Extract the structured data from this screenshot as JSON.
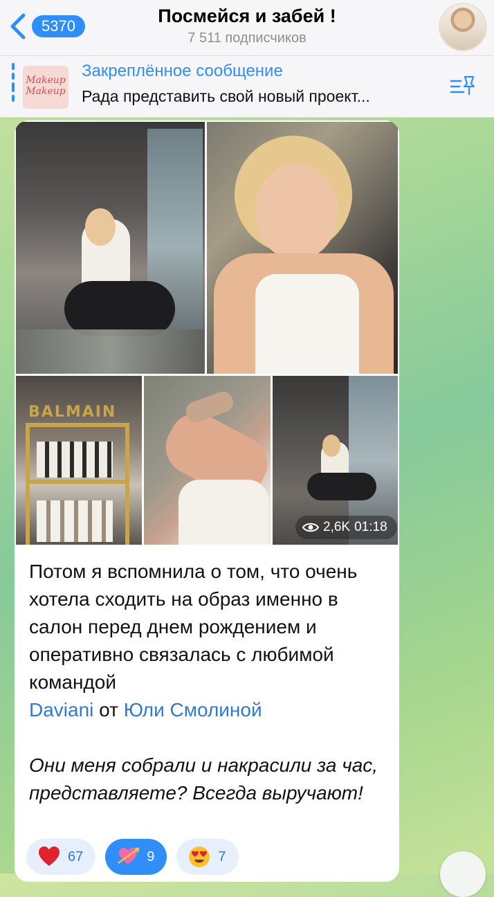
{
  "header": {
    "back_count": "5370",
    "title": "Посмейся и забей !",
    "subscribers": "7 511 подписчиков"
  },
  "pinned": {
    "label": "Закреплённое сообщение",
    "preview": "Рада представить свой новый проект...",
    "thumb_text": "Макеуп Макеуп"
  },
  "media": {
    "sign_text": "BALMAIN",
    "video_views": "2,6K",
    "video_duration": "01:18"
  },
  "message": {
    "line_text": "Потом я вспомнила о том, что очень хотела сходить на образ именно в салон перед днем рождением и оперативно связалась с любимой командой",
    "link1": "Daviani",
    "between": " от ",
    "link2": "Юли Смолиной",
    "italic": "Они меня собрали и накрасили за час, представляете? Всегда выручают!"
  },
  "reactions": [
    {
      "emoji": "heart-icon",
      "count": "67"
    },
    {
      "emoji": "heart-arrow-icon",
      "count": "9"
    },
    {
      "emoji": "heart-eyes-icon",
      "count": "7"
    }
  ],
  "colors": {
    "accent": "#2f8ef7",
    "link": "#2f7ad0",
    "bar_bg": "#f6f6f8"
  }
}
